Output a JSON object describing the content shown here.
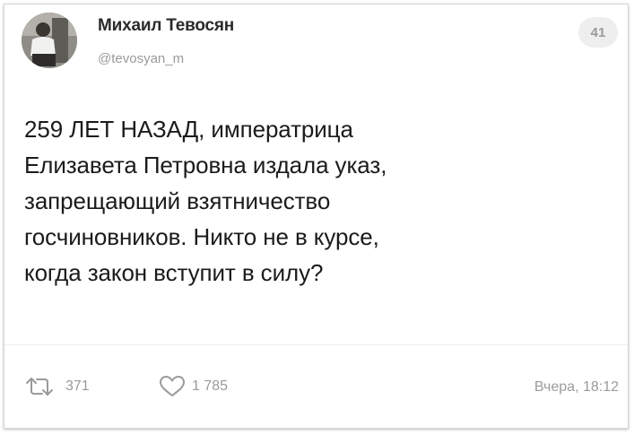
{
  "post": {
    "author_name": "Михаил Тевосян",
    "handle": "@tevosyan_m",
    "counter_badge": "41",
    "text": "259 ЛЕТ НАЗАД, императрица\nЕлизавета Петровна издала указ,\nзапрещающий взятничество\nгосчиновников. Никто не в курсе,\nкогда закон вступит в силу?",
    "reposts": "371",
    "likes": "1 785",
    "timestamp": "Вчера, 18:12"
  },
  "icons": {
    "repost": "repost-icon",
    "like": "heart-icon"
  },
  "colors": {
    "text": "#1b1b1b",
    "muted": "#9a9a9a",
    "badge_bg": "#eeeeee"
  }
}
